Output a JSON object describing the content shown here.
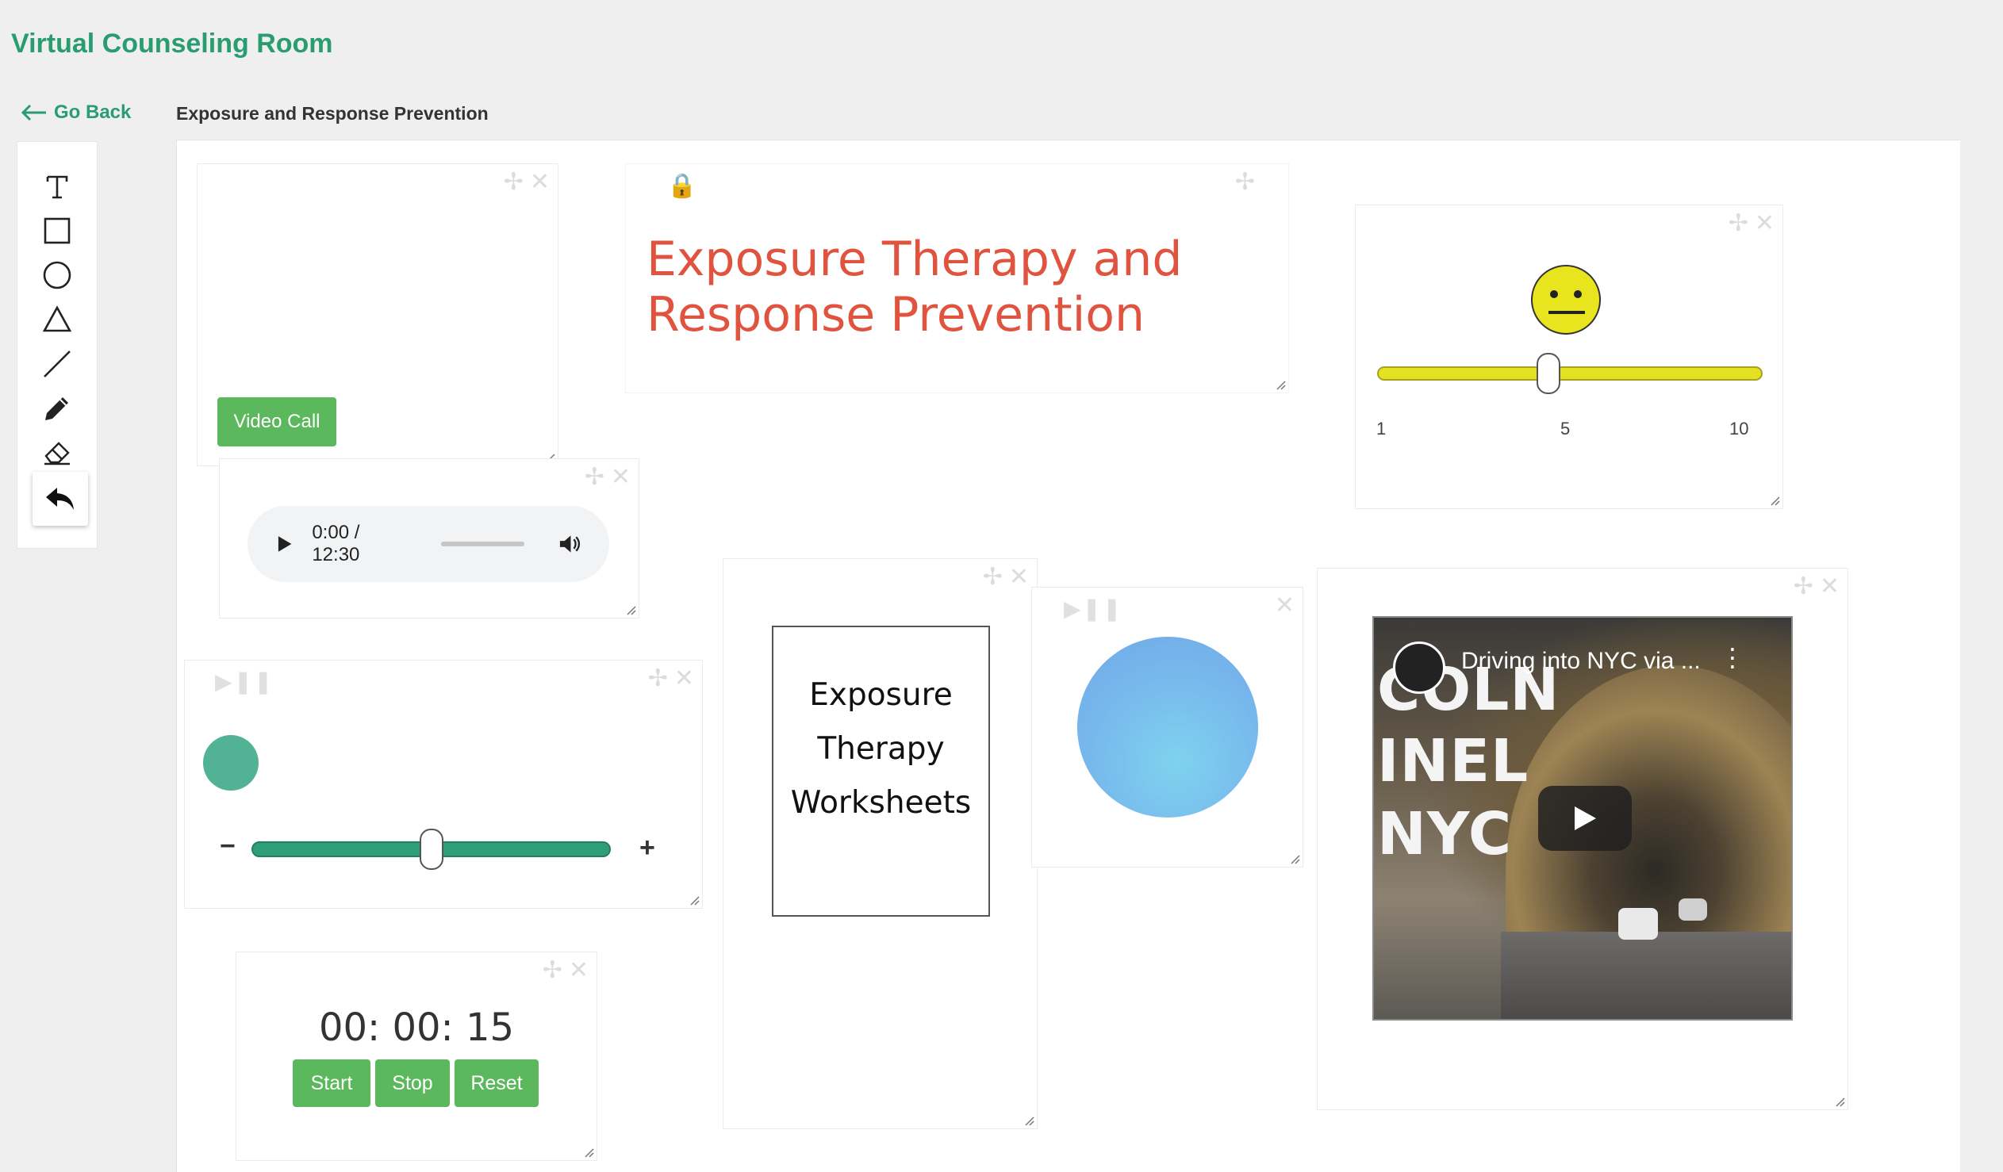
{
  "app": {
    "title": "Virtual Counseling Room"
  },
  "nav": {
    "back_label": "Go Back"
  },
  "page": {
    "subtitle": "Exposure and Response Prevention"
  },
  "toolbar": {
    "tools": [
      "text-tool",
      "rectangle-tool",
      "circle-tool",
      "triangle-tool",
      "line-tool",
      "pencil-tool",
      "eraser-tool",
      "undo-tool"
    ]
  },
  "video_call": {
    "button_label": "Video Call"
  },
  "audio": {
    "time": "0:00 / 12:30"
  },
  "heading": {
    "text": "Exposure Therapy and Response Prevention",
    "color": "#e0533f"
  },
  "mood_slider": {
    "value": 5,
    "min": 1,
    "max": 10,
    "min_label": "1",
    "mid_label": "5",
    "max_label": "10",
    "color": "#e4e123"
  },
  "breathing_slider": {
    "value_fraction": 0.5,
    "minus": "−",
    "plus": "+",
    "color": "#2d9d7a"
  },
  "timer": {
    "display": "00: 00: 15",
    "start_label": "Start",
    "stop_label": "Stop",
    "reset_label": "Reset"
  },
  "worksheet": {
    "line1": "Exposure",
    "line2": "Therapy",
    "line3": "Worksheets"
  },
  "youtube": {
    "title": "Driving into NYC via ...",
    "overlay_line1": "COLN",
    "overlay_line2": "INEL",
    "overlay_line3": "NYC"
  },
  "colors": {
    "brand": "#2a9c72",
    "button": "#5cb85c",
    "circle": "#77b8ec"
  }
}
